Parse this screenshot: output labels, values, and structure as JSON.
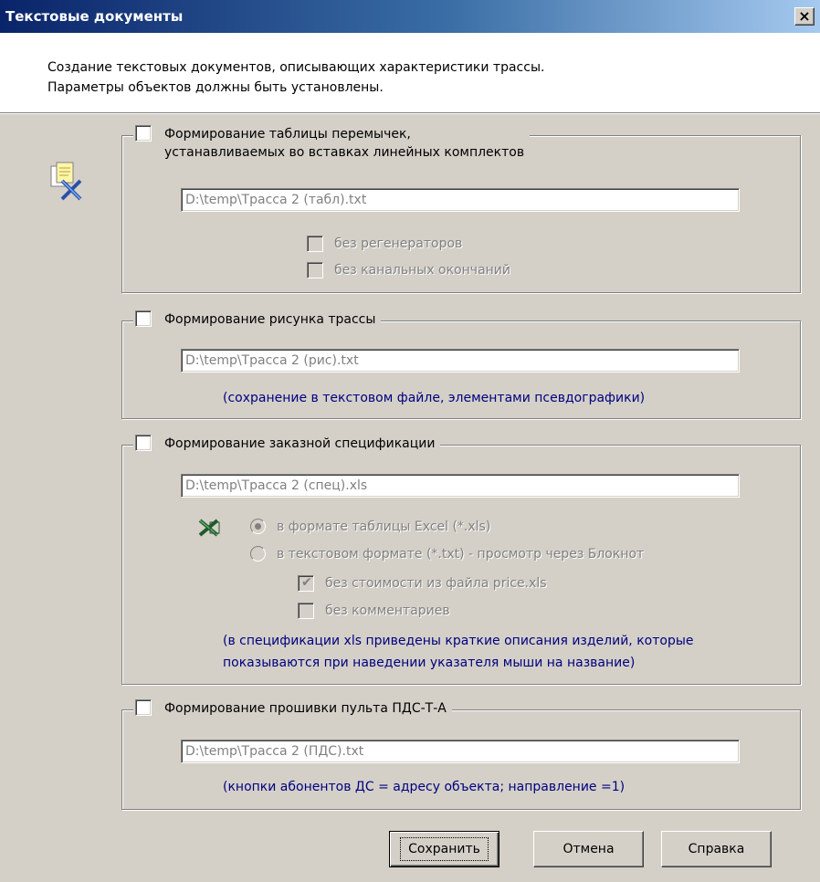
{
  "window": {
    "title": "Текстовые документы",
    "close_label": "×"
  },
  "header": {
    "line1": "Создание текстовых документов, описывающих характеристики трассы.",
    "line2": "Параметры объектов должны быть установлены."
  },
  "group1": {
    "label_line1": "Формирование таблицы перемычек,",
    "label_line2": "устанавливаемых во вставках линейных комплектов",
    "checked": false,
    "path": "D:\\temp\\Трасса 2 (табл).txt",
    "opt1": "без регенераторов",
    "opt2": "без канальных окончаний"
  },
  "group2": {
    "label": "Формирование рисунка трассы",
    "checked": false,
    "path": "D:\\temp\\Трасса 2 (рис).txt",
    "note": "(сохранение в текстовом файле, элементами псевдографики)"
  },
  "group3": {
    "label": "Формирование заказной спецификации",
    "checked": false,
    "path": "D:\\temp\\Трасса 2 (спец).xls",
    "radio_excel": "в формате таблицы Excel (*.xls)",
    "radio_excel_selected": true,
    "radio_txt": "в текстовом формате (*.txt) - просмотр через Блокнот",
    "opt_price": "без стоимости из файла price.xls",
    "opt_price_checked": true,
    "opt_comments": "без комментариев",
    "note_line1": "(в спецификации xls приведены краткие описания изделий, которые",
    "note_line2": "показываются при наведении указателя мыши на название)"
  },
  "group4": {
    "label": "Формирование прошивки пульта ПДС-Т-А",
    "checked": false,
    "path": "D:\\temp\\Трасса 2 (ПДС).txt",
    "note": "(кнопки абонентов ДС = адресу объекта;  направление =1)"
  },
  "buttons": {
    "save": "Сохранить",
    "cancel": "Отмена",
    "help": "Справка"
  },
  "icons": {
    "documents": "documents-icon",
    "excel": "excel-icon"
  }
}
